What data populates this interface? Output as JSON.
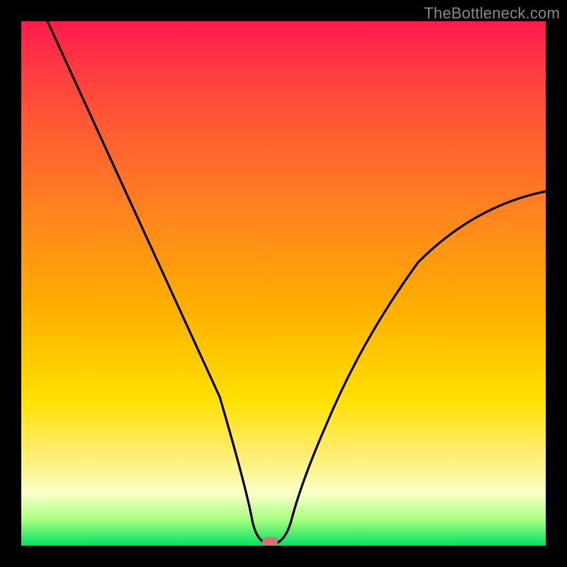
{
  "watermark": "TheBottleneck.com",
  "colors": {
    "frame": "#000000",
    "gradient_top": "#ff1a4d",
    "gradient_bottom": "#00e060",
    "curve": "#000000",
    "marker": "#d4746f"
  },
  "chart_data": {
    "type": "line",
    "title": "",
    "xlabel": "",
    "ylabel": "",
    "xlim": [
      0,
      100
    ],
    "ylim": [
      0,
      100
    ],
    "x": [
      5,
      10,
      15,
      20,
      25,
      30,
      35,
      40,
      43,
      45,
      46,
      47,
      52,
      55,
      60,
      65,
      70,
      75,
      80,
      85,
      90,
      95,
      100
    ],
    "y": [
      100,
      89,
      78,
      67,
      56,
      45,
      34,
      18,
      5,
      1,
      0,
      0,
      2,
      6,
      16,
      27,
      37,
      45,
      52,
      57,
      61,
      64,
      67
    ],
    "marker": {
      "x": 47,
      "y": 0
    },
    "notes": "V-shaped bottleneck curve over a red-to-green vertical gradient; minimum near x≈47 where y≈0."
  }
}
